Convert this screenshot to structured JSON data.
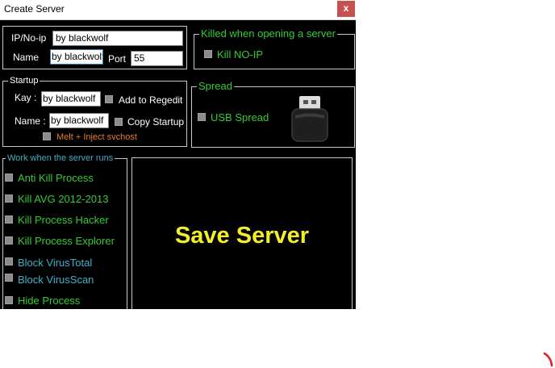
{
  "window": {
    "title": "Create Server",
    "close_label": "x"
  },
  "connection": {
    "ip_label": "IP/No-ip",
    "ip_value": "by blackwolf",
    "name_label": "Name",
    "name_value": "by blackwolf",
    "port_label": "Port",
    "port_value": "55"
  },
  "killed_group": {
    "legend": "Killed when opening a server",
    "kill_noip_label": "Kill NO-IP"
  },
  "startup_group": {
    "legend": "Startup",
    "kay_label": "Kay :",
    "kay_value": "by blackwolf",
    "add_regedit_label": "Add to Regedit",
    "name_label": "Name :",
    "name_value": "by blackwolf",
    "copy_startup_label": "Copy Startup",
    "melt_label": "Melt + Inject svchost"
  },
  "spread_group": {
    "legend": "Spread",
    "usb_spread_label": "USB Spread"
  },
  "work_group": {
    "legend": "Work when the server runs",
    "items": [
      {
        "label": "Anti Kill Process",
        "color": "#33cc33"
      },
      {
        "label": "Kill AVG 2012-2013",
        "color": "#33cc33"
      },
      {
        "label": "Kill Process Hacker",
        "color": "#33cc33"
      },
      {
        "label": "Kill Process Explorer",
        "color": "#33cc33"
      },
      {
        "label": "Block VirusTotal",
        "color": "#3fb0c8"
      },
      {
        "label": "Block VirusScan",
        "color": "#3fb0c8"
      },
      {
        "label": "Hide Process",
        "color": "#33cc33"
      }
    ]
  },
  "save_button": {
    "label": "Save Server"
  },
  "colors": {
    "accent_yellow": "#f4ee2a",
    "green": "#33cc33",
    "teal": "#3fb0c8",
    "orange": "#e57a2d"
  }
}
